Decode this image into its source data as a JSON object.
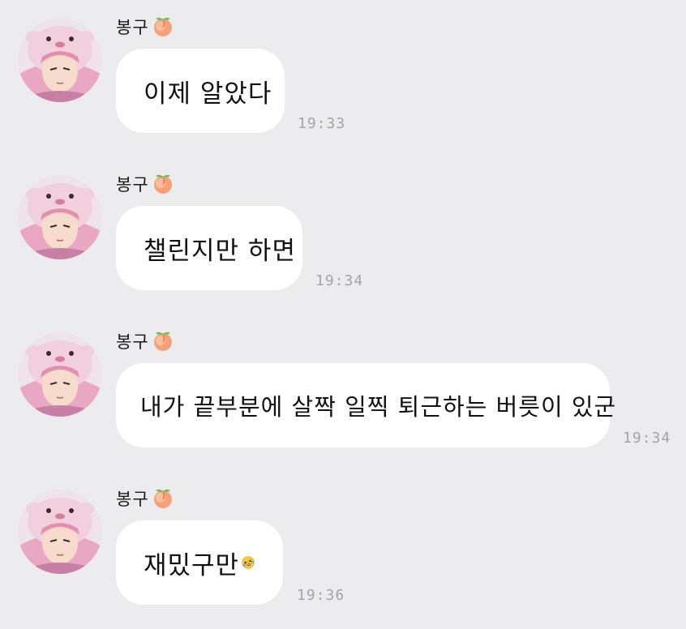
{
  "colors": {
    "background": "#ececee",
    "bubble": "#ffffff",
    "timestamp": "#a4a4a8"
  },
  "messages": [
    {
      "sender": "봉구",
      "sender_icon": "peach-icon",
      "text": "이제 알았다",
      "time": "19:33"
    },
    {
      "sender": "봉구",
      "sender_icon": "peach-icon",
      "text": "챌린지만 하면",
      "time": "19:34"
    },
    {
      "sender": "봉구",
      "sender_icon": "peach-icon",
      "text": "내가 끝부분에 살짝 일찍 퇴근하는 버릇이 있군",
      "time": "19:34"
    },
    {
      "sender": "봉구",
      "sender_icon": "peach-icon",
      "text": "재밌구만",
      "emoji": "rolling-laughing-emoji-icon",
      "time": "19:36"
    }
  ]
}
